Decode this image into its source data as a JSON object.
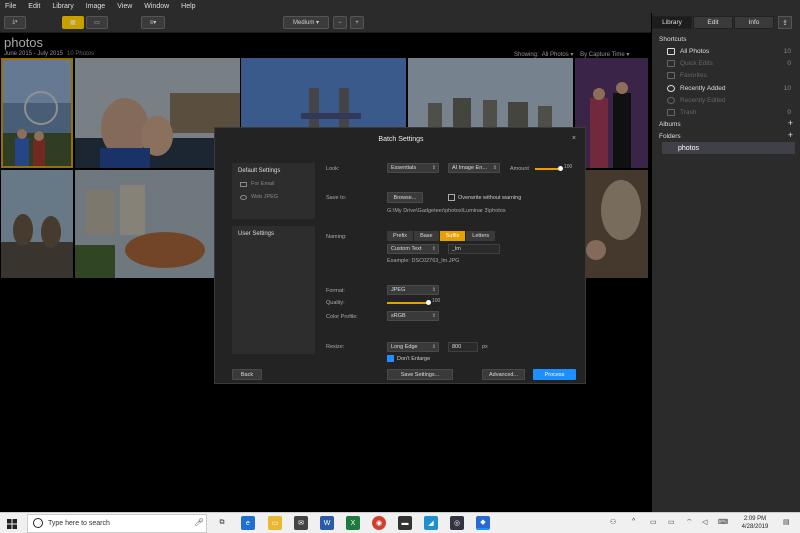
{
  "menu": [
    "File",
    "Edit",
    "Library",
    "Image",
    "View",
    "Window",
    "Help"
  ],
  "toolbar": {
    "zoom_label": "Medium",
    "minus": "−",
    "plus": "+"
  },
  "library": {
    "title": "photos",
    "date_range": "June 2015 - July 2015",
    "count": "10 Photos",
    "showing_label": "Showing:",
    "showing_value": "All Photos",
    "sort_value": "By Capture Time"
  },
  "panel": {
    "tabs": [
      "Library",
      "Edit",
      "Info"
    ],
    "shortcuts_label": "Shortcuts",
    "shortcuts": [
      {
        "label": "All Photos",
        "count": "10"
      },
      {
        "label": "Quick Edits",
        "count": "0"
      },
      {
        "label": "Favorites",
        "count": ""
      },
      {
        "label": "Recently Added",
        "count": "10"
      },
      {
        "label": "Recently Edited",
        "count": ""
      },
      {
        "label": "Trash",
        "count": "0"
      }
    ],
    "albums_label": "Albums",
    "folders_label": "Folders",
    "folder": "photos"
  },
  "dialog": {
    "title": "Batch Settings",
    "close": "×",
    "default_settings": "Default Settings",
    "for_email": "For Email",
    "web_jpeg": "Web JPEG",
    "user_settings": "User Settings",
    "look_label": "Look:",
    "look_value": "Essentials",
    "ai_value": "AI Image En...",
    "amount_label": "Amount",
    "amount_value": "100",
    "amount_fraction": 1.0,
    "save_to_label": "Save to:",
    "browse": "Browse...",
    "overwrite": "Overwrite without warning",
    "path": "G:\\My Drive\\Gadgeteer\\photos\\Luminar 3\\photos",
    "naming_label": "Naming:",
    "naming_tabs": [
      "Prefix",
      "Base",
      "Suffix",
      "Letters"
    ],
    "naming_active": "Suffix",
    "custom_text": "Custom Text",
    "suffix_value": "_lm",
    "example": "Example: DSC02763_lm.JPG",
    "format_label": "Format:",
    "format_value": "JPEG",
    "quality_label": "Quality:",
    "quality_value": "100",
    "color_profile_label": "Color Profile:",
    "color_profile_value": "sRGB",
    "resize_label": "Resize:",
    "resize_value": "Long Edge",
    "resize_px": "800",
    "px_unit": "px",
    "dont_enlarge": "Don't Enlarge",
    "back": "Back",
    "save_settings": "Save Settings...",
    "advanced": "Advanced...",
    "process": "Process"
  },
  "taskbar": {
    "search_placeholder": "Type here to search",
    "time": "2:09 PM",
    "date": "4/28/2019"
  }
}
